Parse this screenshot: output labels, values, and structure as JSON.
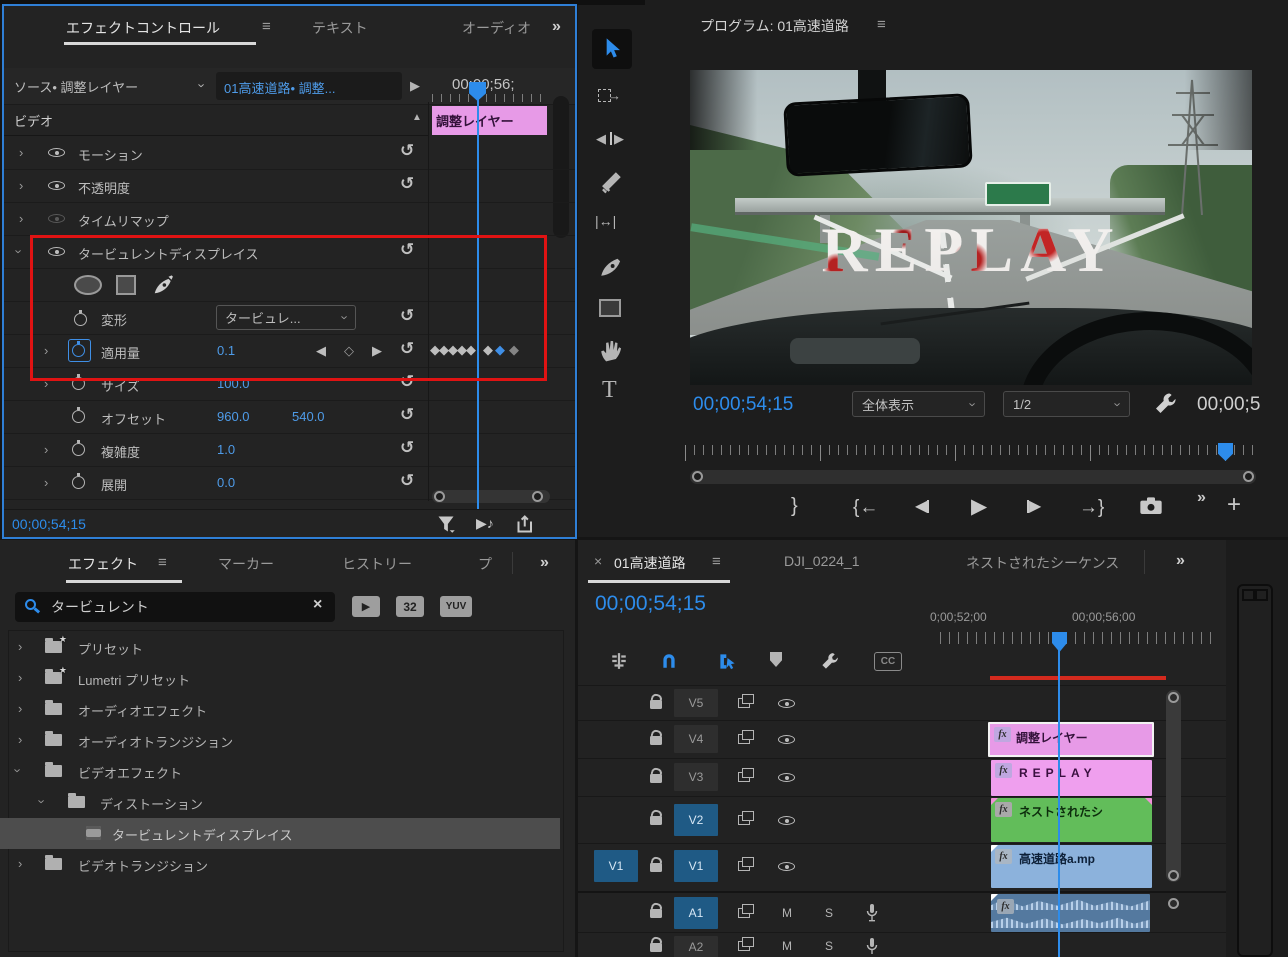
{
  "icons": {
    "menu": "≡",
    "more": "»",
    "chevron": "›",
    "collapse": "▲",
    "dropdown": "∨",
    "play": "▶",
    "rev": "◀",
    "reset": "↺",
    "diamond": "◆",
    "diamond_o": "◇",
    "plus": "+",
    "close": "×",
    "note": "♪",
    "brace_l": "{",
    "brace_r": "}",
    "arrow_l": "←",
    "arrow_r": "→",
    "star": "★",
    "type_tool": "T",
    "slip_tool": "|↔|"
  },
  "colors": {
    "accent_blue": "#2d8ceb",
    "value_blue": "#4e9be8",
    "annotation_red": "#e01313",
    "clip_pink": "#e79ae7",
    "clip_green": "#62bd5a",
    "clip_blue": "#8cb2dc",
    "render_red": "#d42a1e"
  },
  "effect_controls": {
    "tabs": [
      {
        "label": "エフェクトコントロール"
      },
      {
        "label": "テキスト"
      },
      {
        "label": "オーディオ"
      }
    ],
    "source_track": "ソース• 調整レイヤー",
    "clip_menu": "01高速道路• 調整...",
    "ruler_timecode": "00;00;56;",
    "mini_clip": "調整レイヤー",
    "video_section": "ビデオ",
    "motion": "モーション",
    "opacity": "不透明度",
    "time_remap": "タイムリマップ",
    "turbulent": "タービュレントディスプレイス",
    "transform": "変形",
    "transform_value": "タービュレ...",
    "amount": "適用量",
    "amount_value": "0.1",
    "size": "サイズ",
    "size_value": "100.0",
    "offset": "オフセット",
    "offset_x": "960.0",
    "offset_y": "540.0",
    "complexity": "複雑度",
    "complexity_value": "1.0",
    "evolution": "展開",
    "evolution_value": "0.0",
    "timecode": "00;00;54;15"
  },
  "program": {
    "title": "プログラム: 01高速道路",
    "overlay": "REPLAY",
    "timecode": "00;00;54;15",
    "fit": "全体表示",
    "resolution": "1/2",
    "right_timecode": "00;00;5"
  },
  "effects_panel": {
    "tabs": [
      {
        "label": "エフェクト"
      },
      {
        "label": "マーカー"
      },
      {
        "label": "ヒストリー"
      },
      {
        "label": "プ"
      }
    ],
    "search": "タービュレント",
    "badge_32": "32",
    "badge_yuv": "YUV",
    "tree": [
      {
        "label": "プリセット"
      },
      {
        "label": "Lumetri プリセット"
      },
      {
        "label": "オーディオエフェクト"
      },
      {
        "label": "オーディオトランジション"
      },
      {
        "label": "ビデオエフェクト"
      },
      {
        "label": "ディストーション"
      },
      {
        "label": "タービュレントディスプレイス"
      },
      {
        "label": "ビデオトランジション"
      }
    ]
  },
  "timeline": {
    "tabs": [
      {
        "label": "01高速道路"
      },
      {
        "label": "DJI_0224_1"
      },
      {
        "label": "ネストされたシーケンス"
      }
    ],
    "timecode": "00;00;54;15",
    "ruler_start": "0;00;52;00",
    "ruler_end": "00;00;56;00",
    "cc": "CC",
    "fx": "fx",
    "tracks": {
      "v5": "V5",
      "v4": "V4",
      "v3": "V3",
      "v2": "V2",
      "v1": "V1",
      "a1": "A1",
      "a2": "A2",
      "source_v1": "V1",
      "mute": "M",
      "solo": "S"
    },
    "clips": {
      "v4": "調整レイヤー",
      "v3": "REPLAY",
      "v2": "ネストされたシ",
      "v1": "高速道路a.mp"
    }
  }
}
